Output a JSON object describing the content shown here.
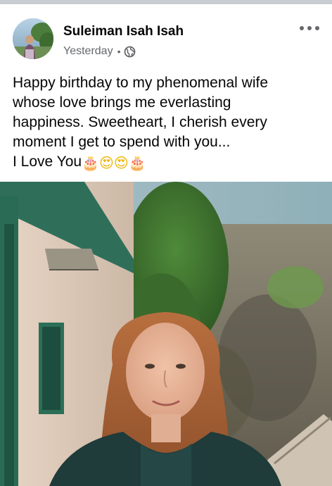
{
  "post": {
    "author_name": "Suleiman Isah Isah",
    "timestamp": "Yesterday",
    "separator": "•",
    "privacy_icon": "globe-icon",
    "more_icon": "more-horizontal-icon",
    "text_lines": [
      "Happy birthday to my phenomenal wife",
      "whose love brings me everlasting",
      "happiness. Sweetheart, I cherish every",
      "moment I get to spend with you..."
    ],
    "last_line_text": "I Love You",
    "emojis": [
      "🎂",
      "😍",
      "😍",
      "🎂"
    ]
  },
  "colors": {
    "secondary_text": "#65676b",
    "primary_text": "#050505",
    "divider": "#c9ccd1"
  }
}
